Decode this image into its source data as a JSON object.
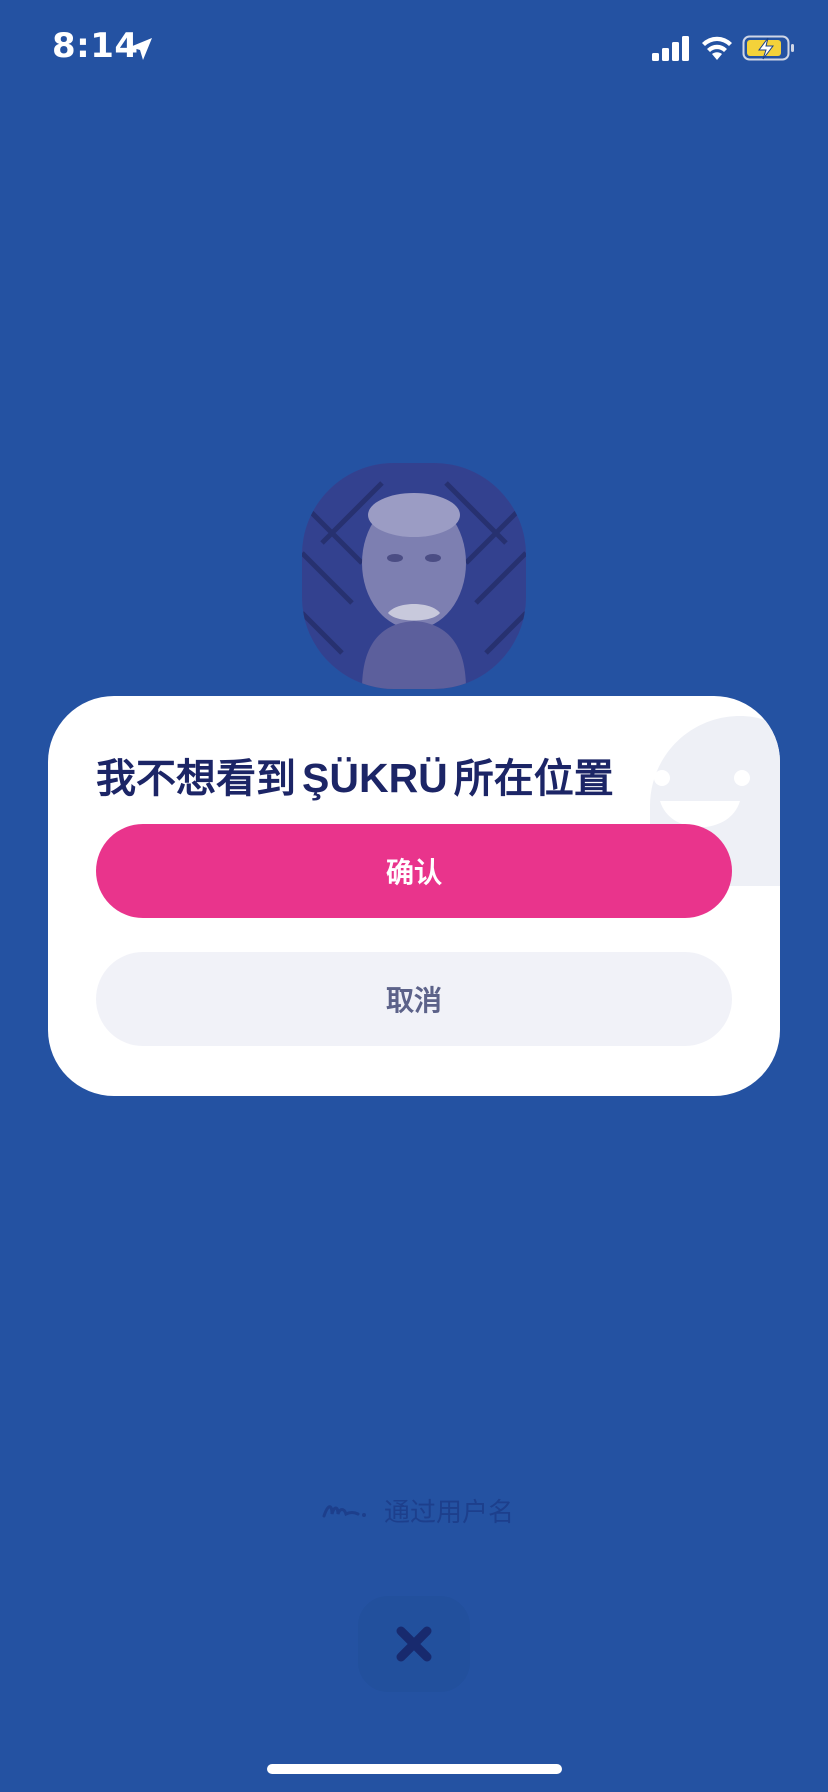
{
  "status_bar": {
    "time": "8:14",
    "icons": [
      "location-arrow-icon",
      "cellular-signal-icon",
      "wifi-icon",
      "battery-charging-icon"
    ]
  },
  "profile": {
    "avatar": "user-avatar-photo"
  },
  "dialog": {
    "title_prefix": "我不想看到",
    "title_name": "ŞÜKRÜ",
    "title_suffix": "所在位置",
    "confirm_label": "确认",
    "cancel_label": "取消"
  },
  "footer": {
    "username_link_label": "通过用户名",
    "close_icon": "close-x-icon"
  },
  "colors": {
    "background": "#2452a2",
    "accent_pink": "#e9348c",
    "title_navy": "#1c2566",
    "cancel_bg": "#f1f2f8",
    "battery_yellow": "#f4d23a"
  }
}
